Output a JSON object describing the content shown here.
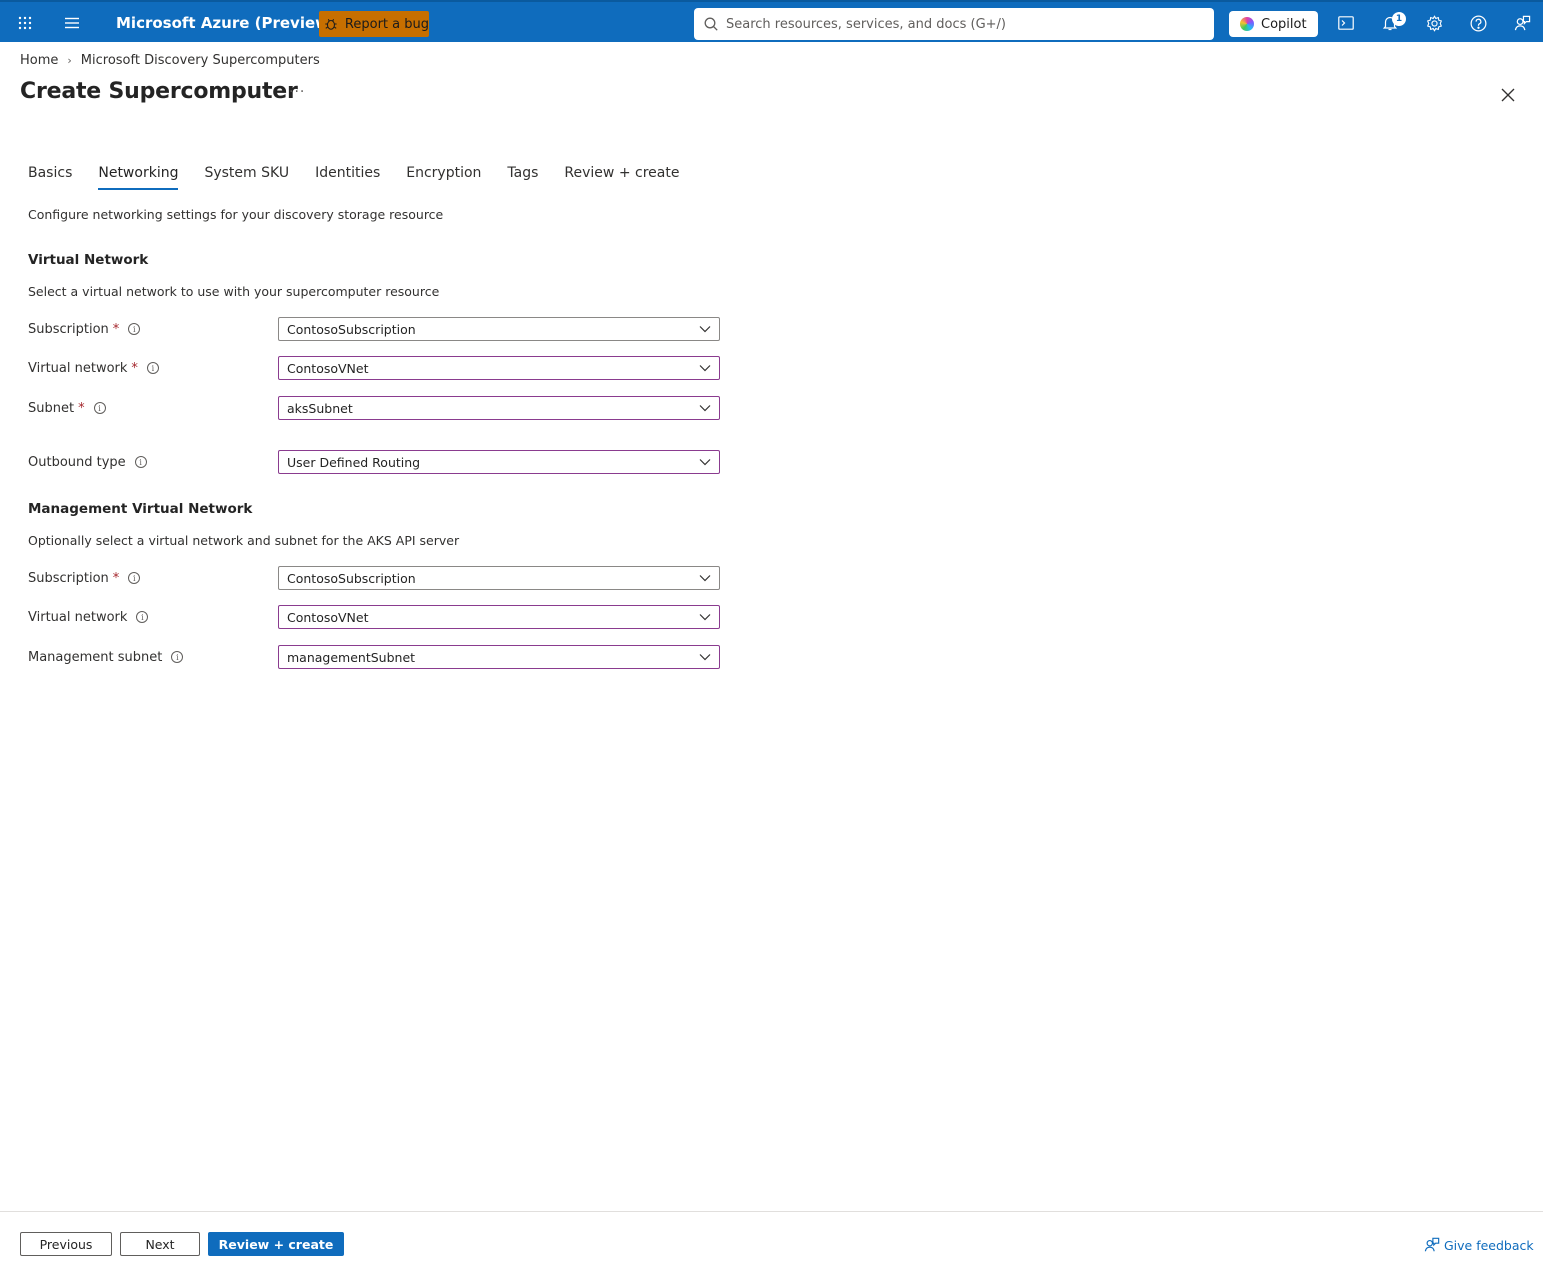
{
  "topbar": {
    "brand": "Microsoft Azure (Preview)",
    "report_bug": "Report a bug",
    "search_placeholder": "Search resources, services, and docs (G+/)",
    "copilot": "Copilot",
    "notification_count": "1"
  },
  "breadcrumb": {
    "home": "Home",
    "service": "Microsoft Discovery Supercomputers"
  },
  "page": {
    "title": "Create Supercomputer",
    "more": "···"
  },
  "tabs": [
    {
      "label": "Basics"
    },
    {
      "label": "Networking",
      "active": true
    },
    {
      "label": "System SKU"
    },
    {
      "label": "Identities"
    },
    {
      "label": "Encryption"
    },
    {
      "label": "Tags"
    },
    {
      "label": "Review + create"
    }
  ],
  "intro": "Configure networking settings for your discovery storage resource",
  "virtual_network": {
    "title": "Virtual Network",
    "description": "Select a virtual network to use with your supercomputer resource",
    "fields": {
      "subscription": {
        "label": "Subscription",
        "required": "*",
        "value": "ContosoSubscription"
      },
      "vnet": {
        "label": "Virtual network",
        "required": "*",
        "value": "ContosoVNet"
      },
      "subnet": {
        "label": "Subnet",
        "required": "*",
        "value": "aksSubnet"
      },
      "outbound": {
        "label": "Outbound type",
        "value": "User Defined Routing"
      }
    }
  },
  "management_network": {
    "title": "Management Virtual Network",
    "description": "Optionally select a virtual network and subnet for the AKS API server",
    "fields": {
      "subscription": {
        "label": "Subscription",
        "required": "*",
        "value": "ContosoSubscription"
      },
      "vnet": {
        "label": "Virtual network",
        "value": "ContosoVNet"
      },
      "subnet": {
        "label": "Management subnet",
        "value": "managementSubnet"
      }
    }
  },
  "footer": {
    "previous": "Previous",
    "next": "Next",
    "review_create": "Review + create",
    "feedback": "Give feedback"
  },
  "colors": {
    "accent": "#0f6cbd",
    "bug_button": "#c76f00",
    "required": "#a4262c",
    "focus_border": "#8a3b8f"
  }
}
